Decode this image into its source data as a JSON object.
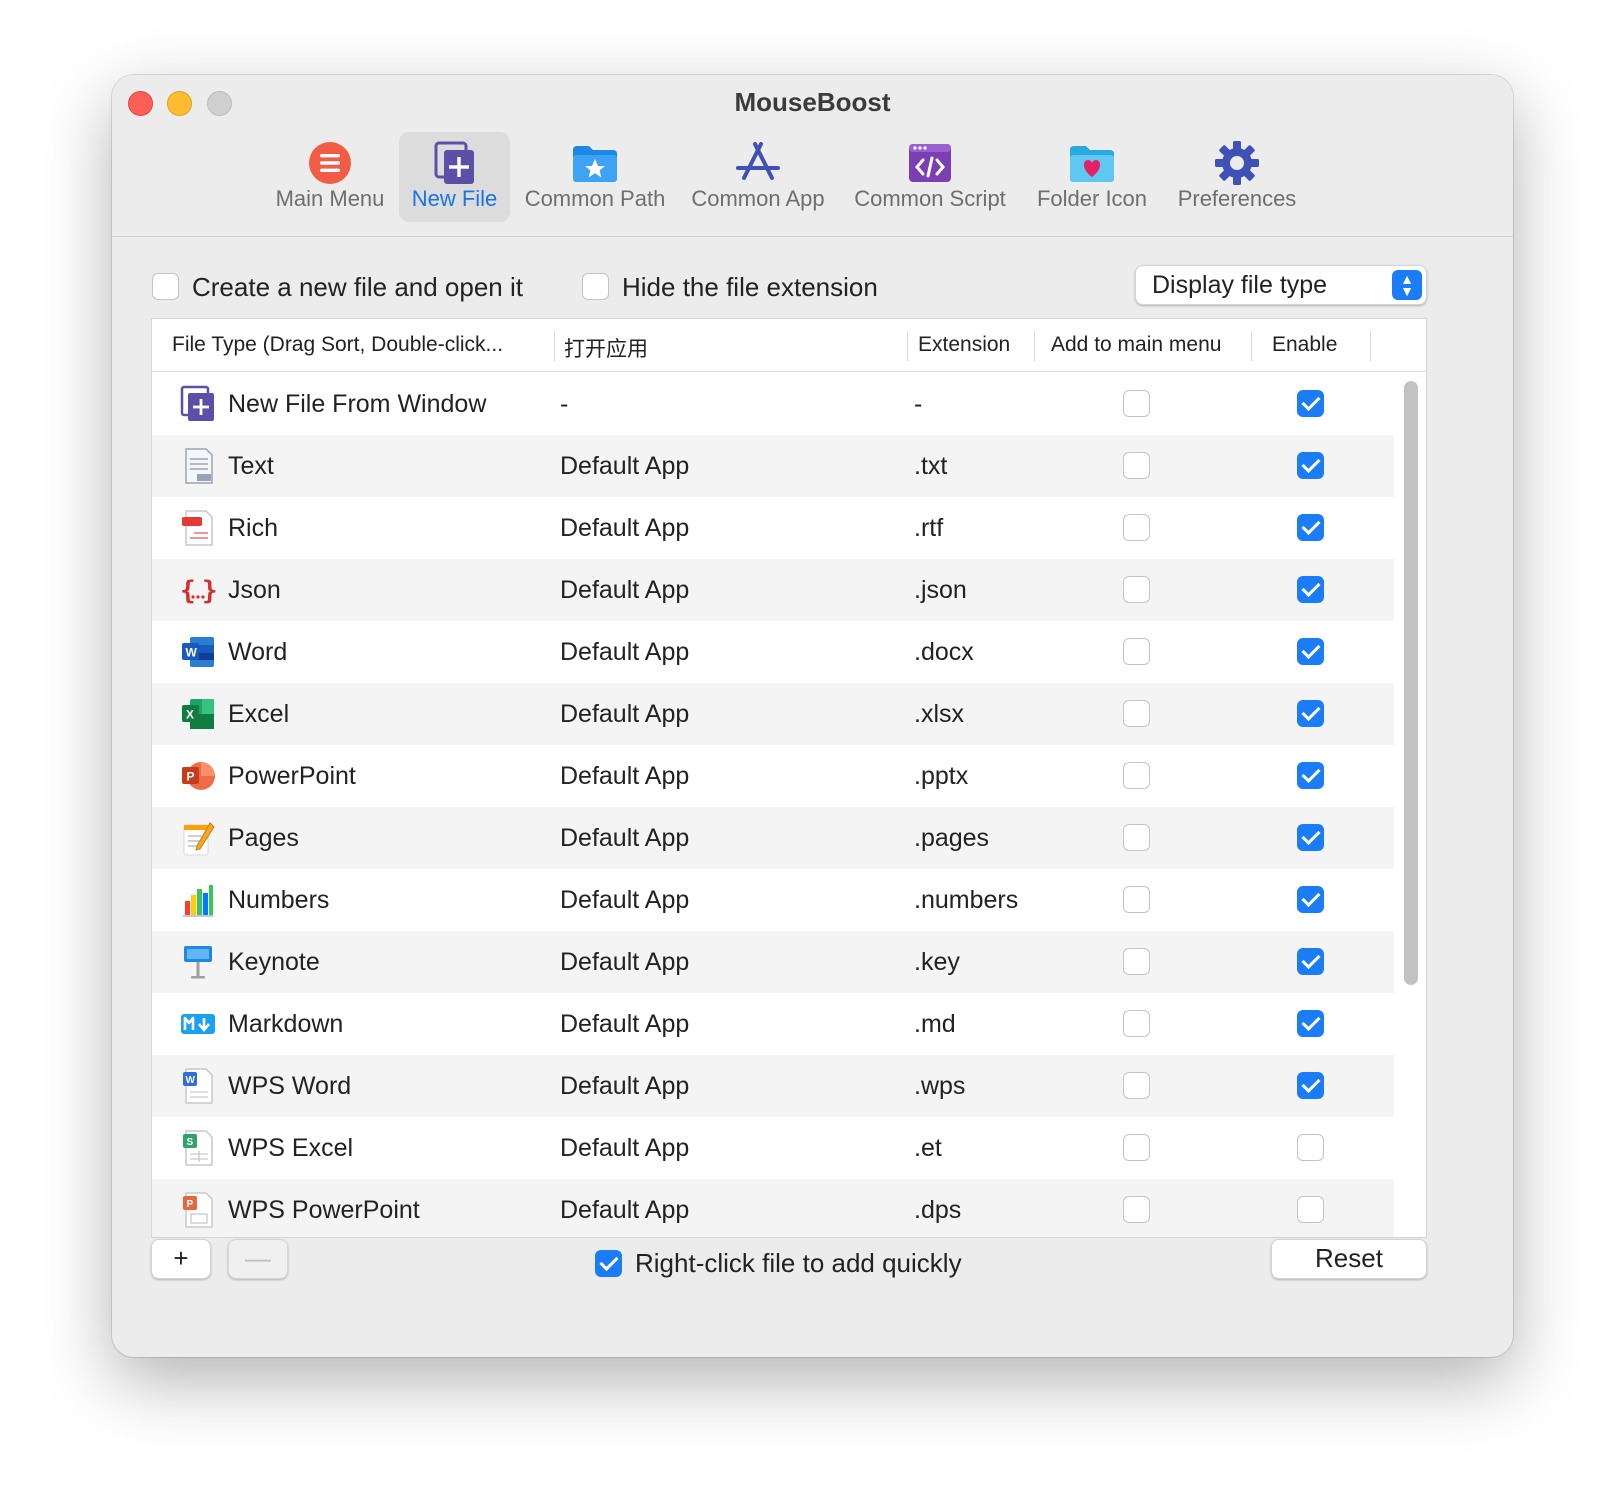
{
  "window": {
    "title": "MouseBoost"
  },
  "toolbar": {
    "items": [
      {
        "label": "Main Menu",
        "icon": "list-circle-icon",
        "active": false
      },
      {
        "label": "New File",
        "icon": "new-file-icon",
        "active": true
      },
      {
        "label": "Common Path",
        "icon": "folder-star-icon",
        "active": false
      },
      {
        "label": "Common App",
        "icon": "app-store-icon",
        "active": false
      },
      {
        "label": "Common Script",
        "icon": "script-icon",
        "active": false
      },
      {
        "label": "Folder Icon",
        "icon": "folder-heart-icon",
        "active": false
      },
      {
        "label": "Preferences",
        "icon": "gear-icon",
        "active": false
      }
    ]
  },
  "options": {
    "create_open_label": "Create a new file and open it",
    "create_open_checked": false,
    "hide_ext_label": "Hide the file extension",
    "hide_ext_checked": false,
    "display_select_value": "Display file type"
  },
  "table": {
    "headers": [
      "File Type (Drag Sort, Double-click...",
      "打开应用",
      "Extension",
      "Add to main menu",
      "Enable"
    ],
    "rows": [
      {
        "name": "New File From Window",
        "app": "-",
        "ext": "-",
        "main_menu": false,
        "enable": true,
        "icon": "new-file-window-icon"
      },
      {
        "name": "Text",
        "app": "Default App",
        "ext": ".txt",
        "main_menu": false,
        "enable": true,
        "icon": "text-file-icon"
      },
      {
        "name": "Rich",
        "app": "Default App",
        "ext": ".rtf",
        "main_menu": false,
        "enable": true,
        "icon": "rtf-file-icon"
      },
      {
        "name": "Json",
        "app": "Default App",
        "ext": ".json",
        "main_menu": false,
        "enable": true,
        "icon": "json-file-icon"
      },
      {
        "name": "Word",
        "app": "Default App",
        "ext": ".docx",
        "main_menu": false,
        "enable": true,
        "icon": "word-icon"
      },
      {
        "name": "Excel",
        "app": "Default App",
        "ext": ".xlsx",
        "main_menu": false,
        "enable": true,
        "icon": "excel-icon"
      },
      {
        "name": "PowerPoint",
        "app": "Default App",
        "ext": ".pptx",
        "main_menu": false,
        "enable": true,
        "icon": "powerpoint-icon"
      },
      {
        "name": "Pages",
        "app": "Default App",
        "ext": ".pages",
        "main_menu": false,
        "enable": true,
        "icon": "pages-icon"
      },
      {
        "name": "Numbers",
        "app": "Default App",
        "ext": ".numbers",
        "main_menu": false,
        "enable": true,
        "icon": "numbers-icon"
      },
      {
        "name": "Keynote",
        "app": "Default App",
        "ext": ".key",
        "main_menu": false,
        "enable": true,
        "icon": "keynote-icon"
      },
      {
        "name": "Markdown",
        "app": "Default App",
        "ext": ".md",
        "main_menu": false,
        "enable": true,
        "icon": "markdown-icon"
      },
      {
        "name": "WPS Word",
        "app": "Default App",
        "ext": ".wps",
        "main_menu": false,
        "enable": true,
        "icon": "wps-word-icon"
      },
      {
        "name": "WPS Excel",
        "app": "Default App",
        "ext": ".et",
        "main_menu": false,
        "enable": false,
        "icon": "wps-excel-icon"
      },
      {
        "name": "WPS PowerPoint",
        "app": "Default App",
        "ext": ".dps",
        "main_menu": false,
        "enable": false,
        "icon": "wps-powerpoint-icon"
      }
    ]
  },
  "footer": {
    "add_label": "+",
    "remove_label": "—",
    "right_click_label": "Right-click file to add quickly",
    "right_click_checked": true,
    "reset_label": "Reset"
  },
  "colors": {
    "accent": "#1a7cf6",
    "active_tab_text": "#1a73e8"
  }
}
